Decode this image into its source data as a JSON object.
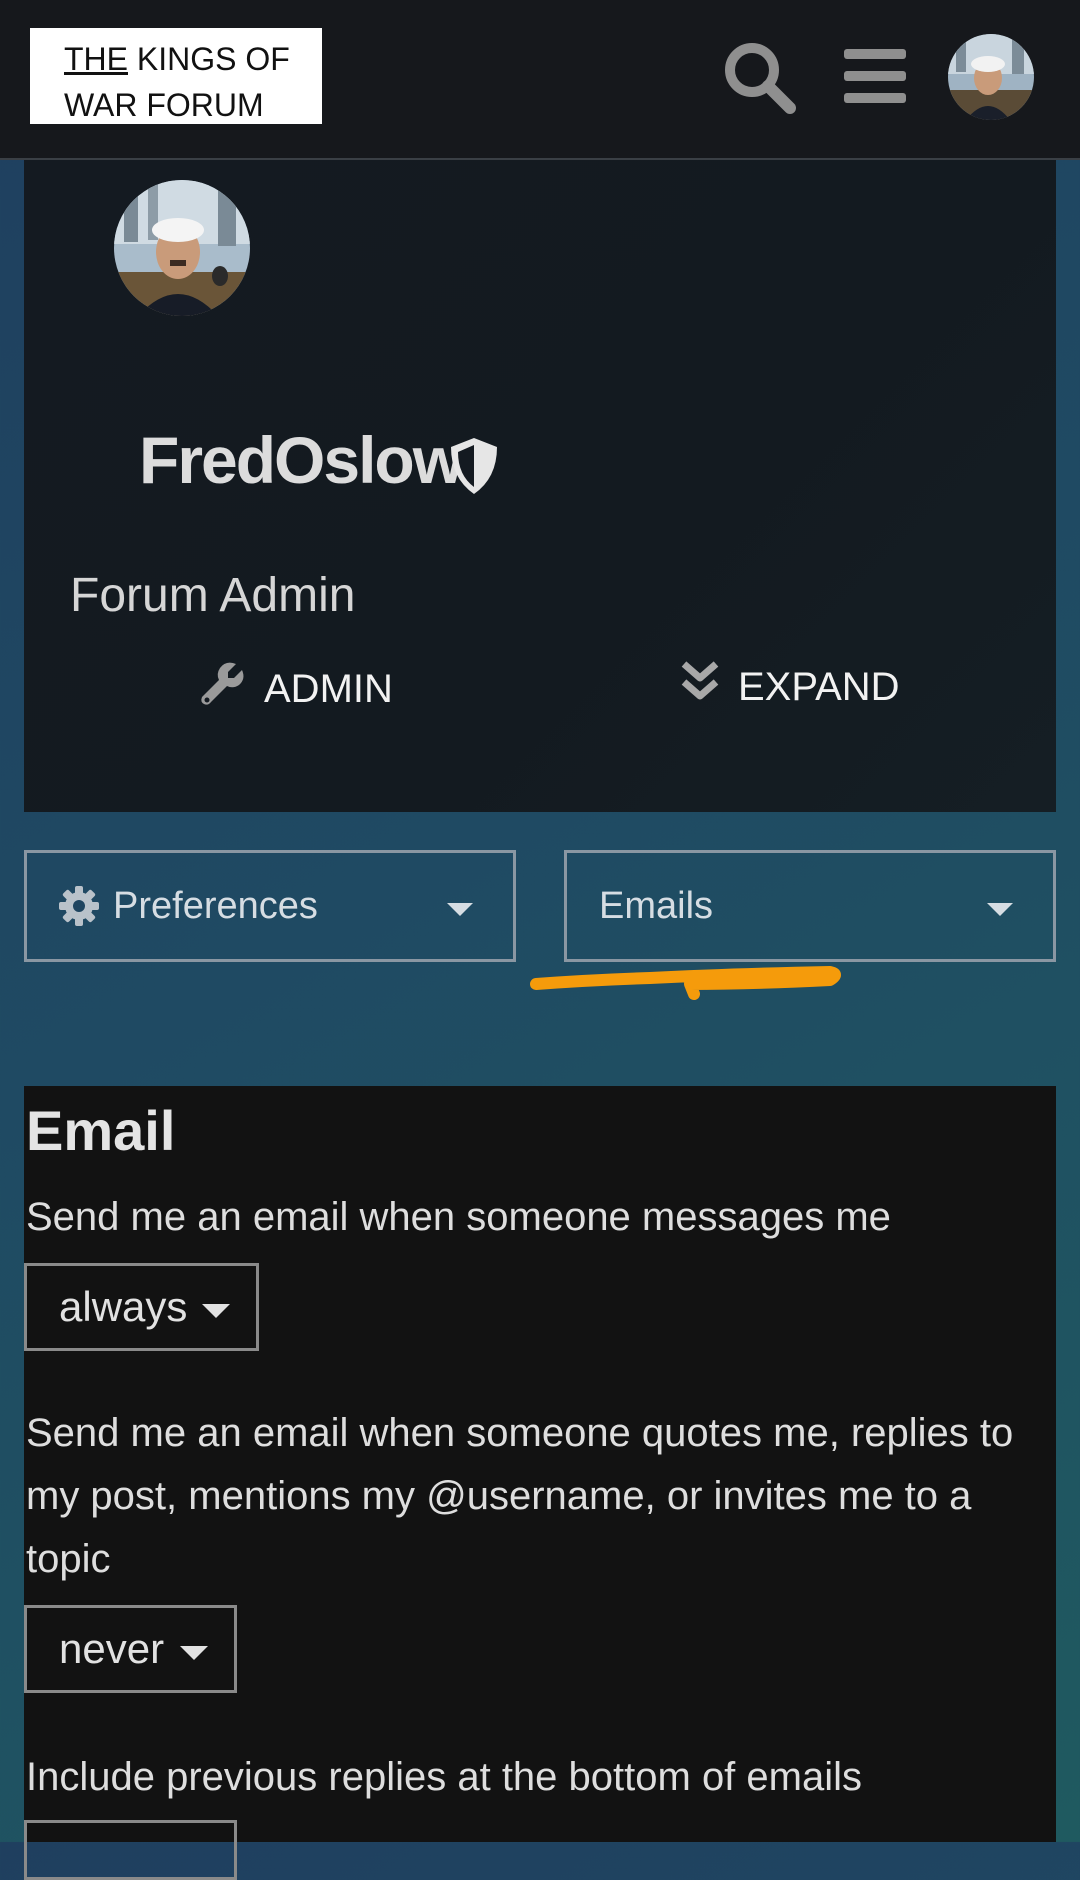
{
  "header": {
    "logo_line1_underlined": "THE",
    "logo_line1_rest": " KINGS OF",
    "logo_line2": "WAR FORUM",
    "icons": [
      "search-icon",
      "hamburger-menu-icon",
      "user-avatar"
    ]
  },
  "profile": {
    "username": "FredOslow",
    "title": "Forum Admin",
    "admin_label": "ADMIN",
    "expand_label": "EXPAND",
    "icons": [
      "shield-icon",
      "wrench-icon",
      "double-chevron-down-icon"
    ]
  },
  "nav": {
    "preferences_label": "Preferences",
    "emails_label": "Emails"
  },
  "email_settings": {
    "heading": "Email",
    "option1_label": "Send me an email when someone messages me",
    "option1_value": "always",
    "option2_label": "Send me an email when someone quotes me, replies to my post, mentions my @username, or invites me to a topic",
    "option2_value": "never",
    "option3_label": "Include previous replies at the bottom of emails"
  },
  "colors": {
    "header_bg": "#16181c",
    "annotation": "#f59b0b",
    "panel_bg": "#121212"
  }
}
